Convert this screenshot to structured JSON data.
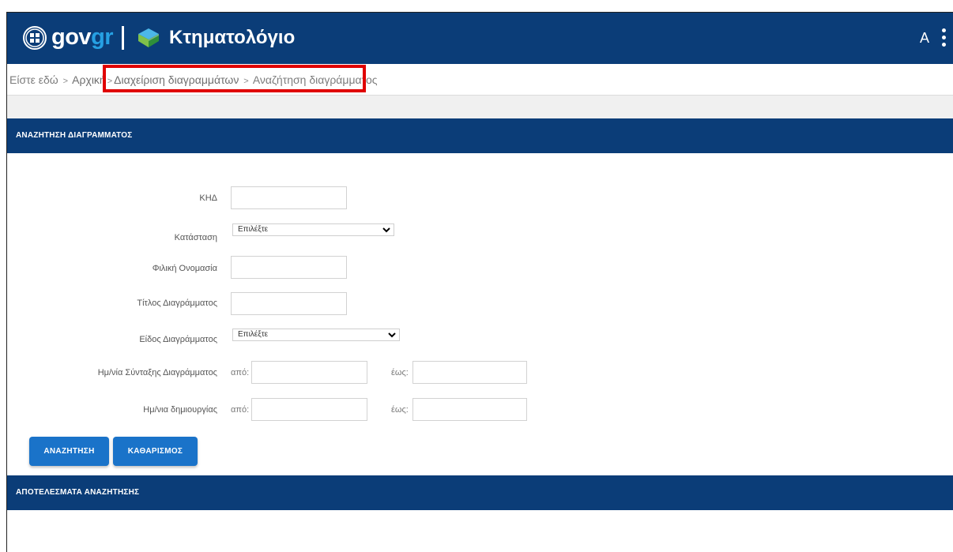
{
  "header": {
    "brand_prefix": "gov",
    "brand_suffix": "gr",
    "app_title": "Κτηματολόγιο",
    "user_initial": "A",
    "colors": {
      "bar": "#0b3d78",
      "gr_accent": "#26a0e3"
    }
  },
  "breadcrumb": {
    "lead": "Είστε εδώ",
    "items": [
      "Αρχική",
      "Διαχείριση διαγραμμάτων",
      "Αναζήτηση διαγράμματος"
    ],
    "separator": ">"
  },
  "search_panel": {
    "title": "ΑΝΑΖΗΤΗΣΗ ΔΙΑΓΡΑΜΜΑΤΟΣ",
    "fields": {
      "khd": {
        "label": "ΚΗΔ",
        "value": ""
      },
      "status": {
        "label": "Κατάσταση",
        "selected": "Επιλέξτε"
      },
      "friendly_name": {
        "label": "Φιλική Ονομασία",
        "value": ""
      },
      "diagram_title": {
        "label": "Τίτλος Διαγράμματος",
        "value": ""
      },
      "diagram_type": {
        "label": "Είδος Διαγράμματος",
        "selected": "Επιλέξτε"
      },
      "compile_date": {
        "label": "Ημ/νία Σύνταξης Διαγράμματος",
        "from_label": "από:",
        "to_label": "έως:",
        "from": "",
        "to": ""
      },
      "creation_date": {
        "label": "Ημ/νια δημιουργίας",
        "from_label": "από:",
        "to_label": "έως:",
        "from": "",
        "to": ""
      }
    },
    "buttons": {
      "search": "ΑΝΑΖΗΤΗΣΗ",
      "clear": "ΚΑΘΑΡΙΣΜΟΣ"
    },
    "button_color": "#1a73c9"
  },
  "results_panel": {
    "title": "ΑΠΟΤΕΛΕΣΜΑΤΑ ΑΝΑΖΗΤΗΣΗΣ"
  }
}
